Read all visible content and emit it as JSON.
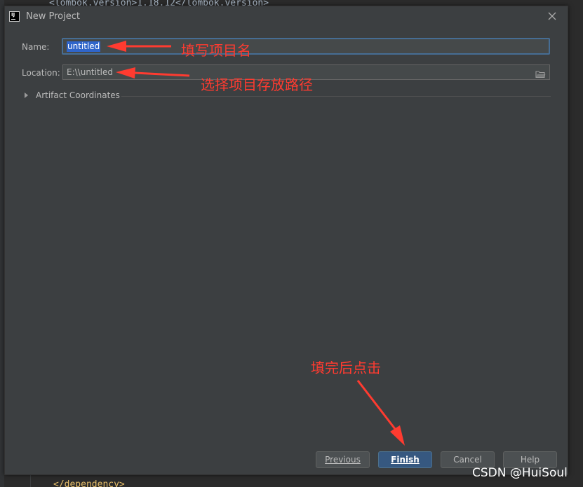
{
  "background": {
    "code_top": "<lombok.version>1.18.12</lombok.version>",
    "code_bottom": "</dependency>"
  },
  "dialog": {
    "title": "New Project",
    "icon": "intellij-idea-icon",
    "close_icon": "close-icon",
    "name_label": "Name:",
    "name_value": "untitled",
    "location_label": "Location:",
    "location_value": "E:\\\\untitled",
    "folder_icon": "folder-icon",
    "artifact_section": "Artifact Coordinates",
    "buttons": {
      "previous": "Previous",
      "finish": "Finish",
      "cancel": "Cancel",
      "help": "Help"
    }
  },
  "annotations": {
    "name_note": "填写项目名",
    "location_note": "选择项目存放路径",
    "finish_note": "填完后点击",
    "color": "#ff3b30"
  },
  "watermark": "CSDN @HuiSoul",
  "colors": {
    "dialog_bg": "#3c3f41",
    "field_bg": "#45494a",
    "focus_border": "#466d94",
    "selection": "#2f65ca",
    "primary_button": "#365880"
  }
}
